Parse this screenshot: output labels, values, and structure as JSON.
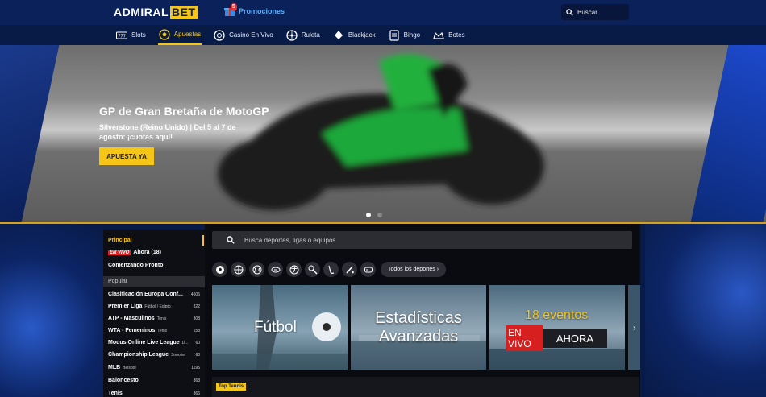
{
  "header": {
    "logo_left": "ADMIRAL",
    "logo_right": "BET",
    "promo_label": "Promociones",
    "promo_count": "5",
    "search_label": "Buscar"
  },
  "nav": {
    "items": [
      {
        "label": "Slots",
        "icon": "slots-icon"
      },
      {
        "label": "Apuestas",
        "icon": "ball-icon",
        "active": true
      },
      {
        "label": "Casino En Vivo",
        "icon": "chip-icon"
      },
      {
        "label": "Ruleta",
        "icon": "roulette-icon"
      },
      {
        "label": "Blackjack",
        "icon": "cards-icon"
      },
      {
        "label": "Bingo",
        "icon": "bingo-icon"
      },
      {
        "label": "Botes",
        "icon": "jackpot-icon"
      }
    ]
  },
  "hero": {
    "title": "GP de Gran Bretaña de MotoGP",
    "subtitle": "Silverstone (Reino Unido) | Del 5 al 7 de agosto: ¡cuotas aquí!",
    "cta": "APUESTA YA"
  },
  "sidebar": {
    "principal": "Principal",
    "en_vivo_badge": "EN VIVO",
    "ahora": "Ahora (18)",
    "comenzando": "Comenzando Pronto",
    "popular": "Popular",
    "leagues": [
      {
        "name": "Clasificación Europa Conf...",
        "sub": "",
        "count": "4605"
      },
      {
        "name": "Premier Liga",
        "sub": "Fútbol / Egipto",
        "count": "822"
      },
      {
        "name": "ATP - Masculinos",
        "sub": "Tenis",
        "count": "308"
      },
      {
        "name": "WTA - Femeninos",
        "sub": "Tenis",
        "count": "158"
      },
      {
        "name": "Modus Online Live League",
        "sub": "D...",
        "count": "60"
      },
      {
        "name": "Championship League",
        "sub": "Snooker",
        "count": "60"
      },
      {
        "name": "MLB",
        "sub": "Béisbol",
        "count": "1195"
      },
      {
        "name": "Baloncesto",
        "sub": "",
        "count": "868"
      },
      {
        "name": "Tenis",
        "sub": "",
        "count": "866"
      }
    ]
  },
  "main": {
    "search_placeholder": "Busca deportes, ligas o equipos",
    "all_sports": "Todos los deportes",
    "sport_icons": [
      "soccer-icon",
      "basketball-icon",
      "tennis-icon",
      "football-icon",
      "volleyball-icon",
      "table-tennis-icon",
      "ice-hockey-icon",
      "cricket-icon",
      "esports-icon"
    ],
    "card1_text": "Fútbol",
    "card2_text": "Estadísticas Avanzadas",
    "card3_title": "18 eventos",
    "card3_live": "EN VIVO",
    "card3_now": "AHORA",
    "top_tennis": "Top Tennis"
  }
}
